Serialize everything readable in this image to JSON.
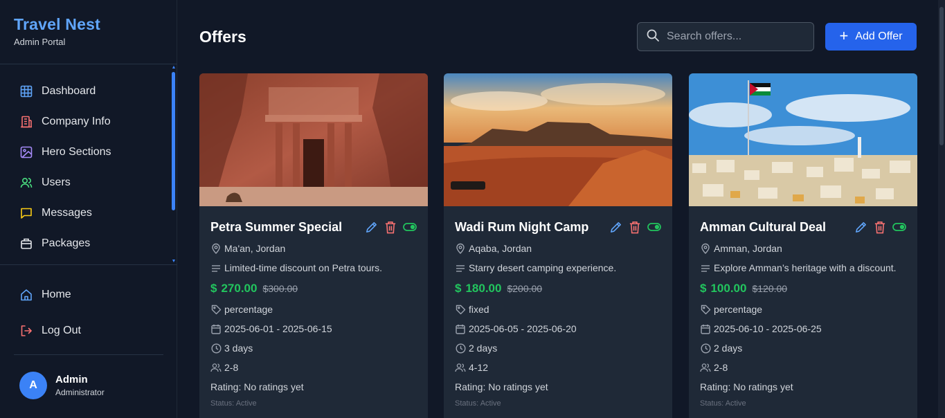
{
  "brand": {
    "title": "Travel Nest",
    "subtitle": "Admin Portal"
  },
  "nav": [
    {
      "label": "Dashboard",
      "icon": "grid-icon",
      "color": "#60a5fa"
    },
    {
      "label": "Company Info",
      "icon": "building-icon",
      "color": "#f87171"
    },
    {
      "label": "Hero Sections",
      "icon": "image-icon",
      "color": "#a78bfa"
    },
    {
      "label": "Users",
      "icon": "users-icon",
      "color": "#4ade80"
    },
    {
      "label": "Messages",
      "icon": "message-icon",
      "color": "#facc15"
    },
    {
      "label": "Packages",
      "icon": "package-icon",
      "color": "#e5e7eb"
    }
  ],
  "bottom_nav": [
    {
      "label": "Home",
      "icon": "home-icon",
      "color": "#60a5fa"
    },
    {
      "label": "Log Out",
      "icon": "logout-icon",
      "color": "#f87171"
    }
  ],
  "user": {
    "initial": "A",
    "name": "Admin",
    "role": "Administrator"
  },
  "page": {
    "title": "Offers"
  },
  "search": {
    "placeholder": "Search offers..."
  },
  "add_button": {
    "label": "Add Offer"
  },
  "offers": [
    {
      "title": "Petra Summer Special",
      "location": "Ma'an, Jordan",
      "description": "Limited-time discount on Petra tours.",
      "price": "$270.00",
      "old_price": "$300.00",
      "discount_type": "percentage",
      "dates": "2025-06-01 - 2025-06-15",
      "duration": "3 days",
      "group_size": "2-8",
      "rating": "Rating: No ratings yet",
      "status": "Status: Active",
      "image": "petra-treasury"
    },
    {
      "title": "Wadi Rum Night Camp",
      "location": "Aqaba, Jordan",
      "description": "Starry desert camping experience.",
      "price": "$180.00",
      "old_price": "$200.00",
      "discount_type": "fixed",
      "dates": "2025-06-05 - 2025-06-20",
      "duration": "2 days",
      "group_size": "4-12",
      "rating": "Rating: No ratings yet",
      "status": "Status: Active",
      "image": "wadi-rum-desert"
    },
    {
      "title": "Amman Cultural Deal",
      "location": "Amman, Jordan",
      "description": "Explore Amman’s heritage with a discount.",
      "price": "$100.00",
      "old_price": "$120.00",
      "discount_type": "percentage",
      "dates": "2025-06-10 - 2025-06-25",
      "duration": "2 days",
      "group_size": "2-8",
      "rating": "Rating: No ratings yet",
      "status": "Status: Active",
      "image": "amman-city-flag"
    }
  ],
  "colors": {
    "accent": "#3b82f6",
    "button": "#2563eb",
    "price": "#22c55e",
    "background": "#111827",
    "card": "#1f2937"
  }
}
